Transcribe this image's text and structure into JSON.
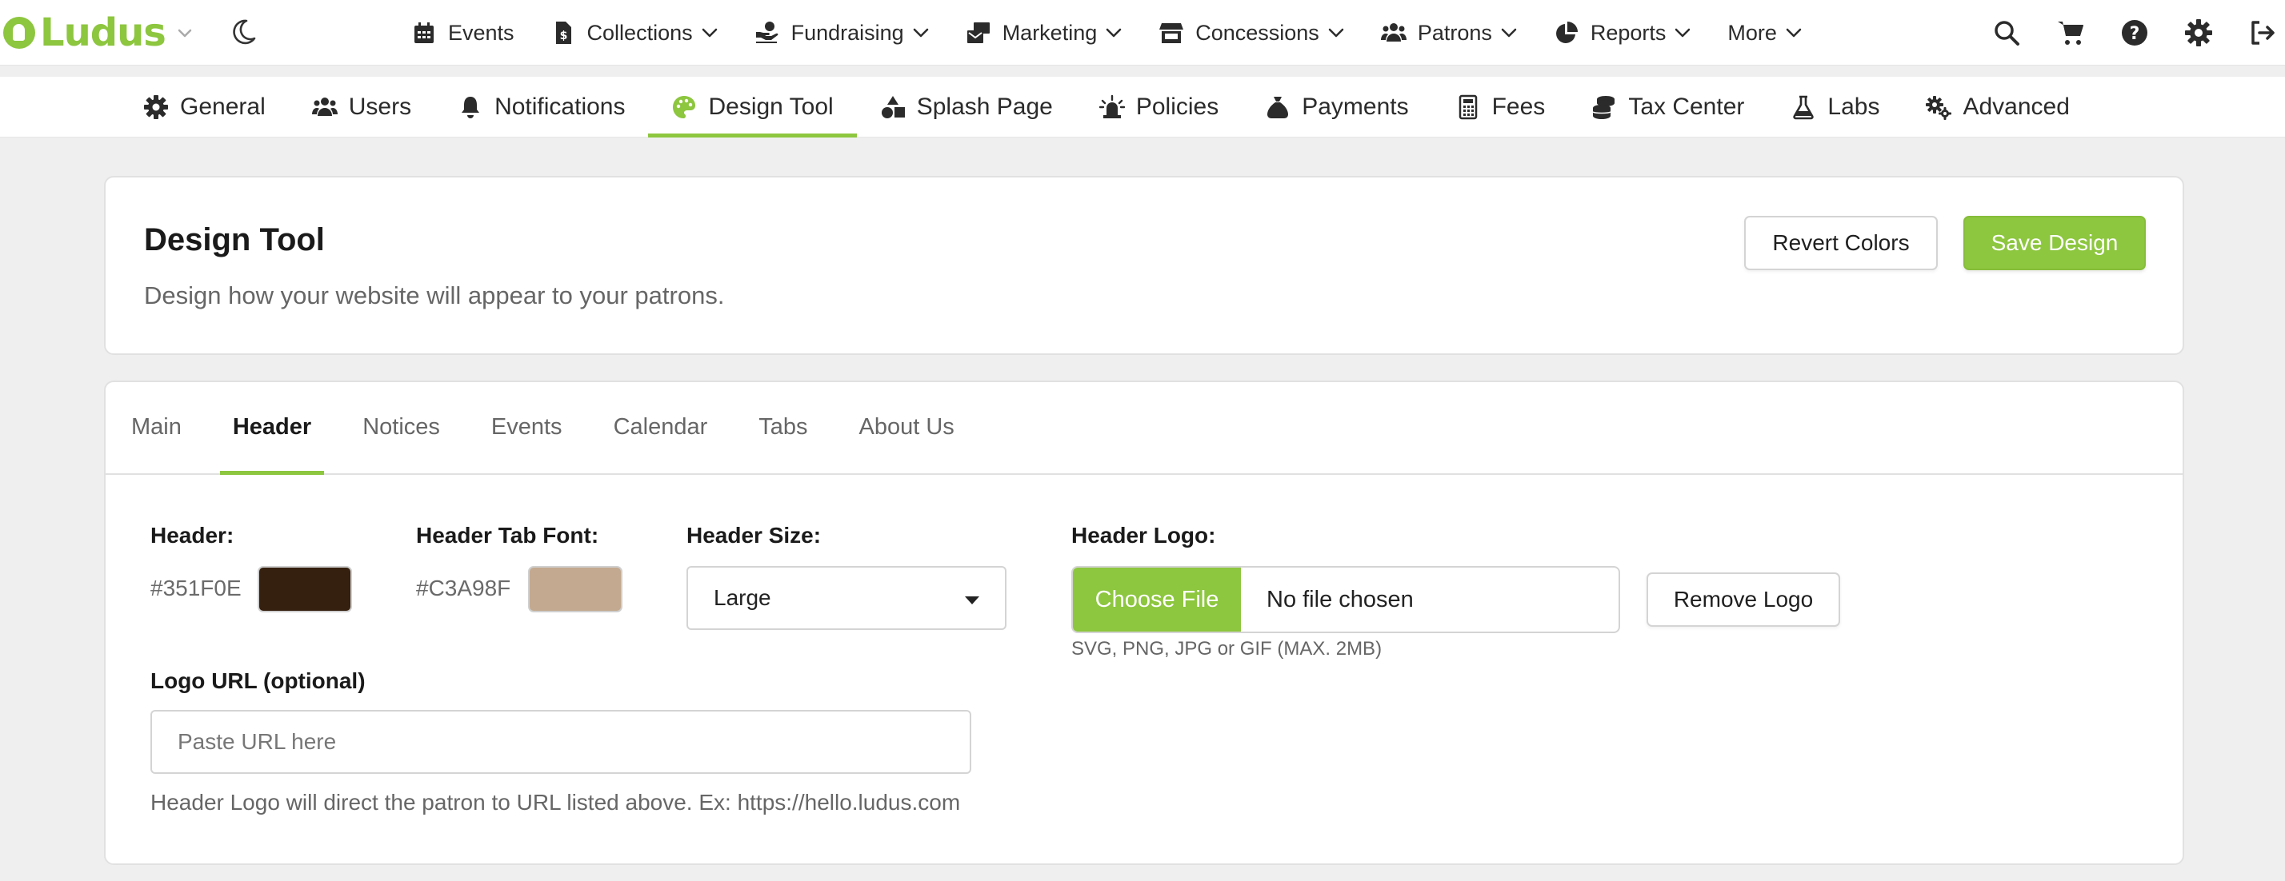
{
  "brand": {
    "name": "Ludus",
    "accent": "#8dc63f"
  },
  "topnav": {
    "items": [
      {
        "label": "Events",
        "icon": "calendar-icon",
        "dropdown": false
      },
      {
        "label": "Collections",
        "icon": "document-dollar-icon",
        "dropdown": true
      },
      {
        "label": "Fundraising",
        "icon": "hand-coin-icon",
        "dropdown": true
      },
      {
        "label": "Marketing",
        "icon": "mail-bulk-icon",
        "dropdown": true
      },
      {
        "label": "Concessions",
        "icon": "store-icon",
        "dropdown": true
      },
      {
        "label": "Patrons",
        "icon": "users-icon",
        "dropdown": true
      },
      {
        "label": "Reports",
        "icon": "pie-chart-icon",
        "dropdown": true
      },
      {
        "label": "More",
        "icon": "",
        "dropdown": true
      }
    ],
    "right_icons": [
      "search-icon",
      "cart-icon",
      "help-icon",
      "gear-icon",
      "sign-out-icon"
    ]
  },
  "subnav": {
    "items": [
      {
        "label": "General",
        "icon": "gear-icon"
      },
      {
        "label": "Users",
        "icon": "users-icon"
      },
      {
        "label": "Notifications",
        "icon": "bell-icon"
      },
      {
        "label": "Design Tool",
        "icon": "palette-icon",
        "active": true
      },
      {
        "label": "Splash Page",
        "icon": "shapes-icon"
      },
      {
        "label": "Policies",
        "icon": "siren-icon"
      },
      {
        "label": "Payments",
        "icon": "money-bag-icon"
      },
      {
        "label": "Fees",
        "icon": "calculator-icon"
      },
      {
        "label": "Tax Center",
        "icon": "coins-icon"
      },
      {
        "label": "Labs",
        "icon": "flask-icon"
      },
      {
        "label": "Advanced",
        "icon": "gears-icon"
      }
    ]
  },
  "page": {
    "title": "Design Tool",
    "description": "Design how your website will appear to your patrons.",
    "revert_label": "Revert Colors",
    "save_label": "Save Design"
  },
  "tabs": [
    "Main",
    "Header",
    "Notices",
    "Events",
    "Calendar",
    "Tabs",
    "About Us"
  ],
  "active_tab": "Header",
  "header_form": {
    "header_label": "Header:",
    "header_color": "#351F0E",
    "tab_font_label": "Header Tab Font:",
    "tab_font_color": "#C3A98F",
    "size_label": "Header Size:",
    "size_value": "Large",
    "logo_label": "Header Logo:",
    "choose_file": "Choose File",
    "no_file": "No file chosen",
    "remove_logo": "Remove Logo",
    "file_hint": "SVG, PNG, JPG or GIF (MAX. 2MB)",
    "url_label": "Logo URL (optional)",
    "url_placeholder": "Paste URL here",
    "url_help": "Header Logo will direct the patron to URL listed above. Ex: https://hello.ludus.com"
  }
}
